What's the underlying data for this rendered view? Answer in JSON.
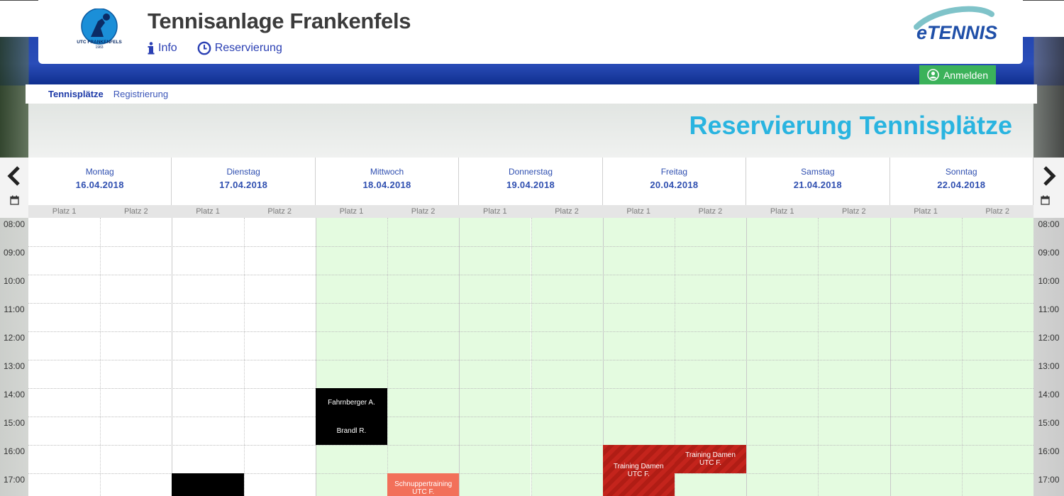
{
  "header": {
    "site_title": "Tennisanlage Frankenfels",
    "logo_text": "UTC FRANKENFELS",
    "logo_year": "1983",
    "brand": "eTENNIS",
    "nav": [
      {
        "label": "Info",
        "icon": "info-icon"
      },
      {
        "label": "Reservierung",
        "icon": "clock-icon"
      }
    ],
    "login_label": "Anmelden"
  },
  "subnav": [
    "Tennisplätze",
    "Registrierung"
  ],
  "page_title": "Reservierung Tennisplätze",
  "calendar": {
    "days": [
      {
        "name": "Montag",
        "date": "16.04.2018"
      },
      {
        "name": "Dienstag",
        "date": "17.04.2018"
      },
      {
        "name": "Mittwoch",
        "date": "18.04.2018"
      },
      {
        "name": "Donnerstag",
        "date": "19.04.2018"
      },
      {
        "name": "Freitag",
        "date": "20.04.2018"
      },
      {
        "name": "Samstag",
        "date": "21.04.2018"
      },
      {
        "name": "Sonntag",
        "date": "22.04.2018"
      }
    ],
    "courts": [
      "Platz 1",
      "Platz 2"
    ],
    "times": [
      "08:00",
      "09:00",
      "10:00",
      "11:00",
      "12:00",
      "13:00",
      "14:00",
      "15:00",
      "16:00",
      "17:00"
    ],
    "events": [
      {
        "label": "Fahrnberger A.",
        "sub": "",
        "day": "18.04.2018",
        "court": "Platz 1",
        "start": "14:00",
        "end": "15:00",
        "color": "#000000"
      },
      {
        "label": "Brandl R.",
        "sub": "",
        "day": "18.04.2018",
        "court": "Platz 1",
        "start": "15:00",
        "end": "16:00",
        "color": "#000000"
      },
      {
        "label": "Schnuppertraining",
        "sub": "UTC F.",
        "day": "18.04.2018",
        "court": "Platz 2",
        "start": "17:00",
        "end": "18:00",
        "color": "#f2705a"
      },
      {
        "label": "",
        "sub": "",
        "day": "17.04.2018",
        "court": "Platz 1",
        "start": "17:00",
        "end": "18:00",
        "color": "#000000"
      },
      {
        "label": "Training Damen",
        "sub": "UTC F.",
        "day": "20.04.2018",
        "court": "Platz 1",
        "start": "16:00",
        "end": "18:00",
        "color": "#c4241c"
      },
      {
        "label": "Training Damen",
        "sub": "UTC F.",
        "day": "20.04.2018",
        "court": "Platz 2",
        "start": "16:00",
        "end": "17:00",
        "color": "#c4241c"
      }
    ]
  },
  "colors": {
    "accent_blue": "#2a3fb3",
    "title_cyan": "#29b4e0",
    "login_green": "#3bb25a",
    "available_green": "#e4fbe0"
  }
}
